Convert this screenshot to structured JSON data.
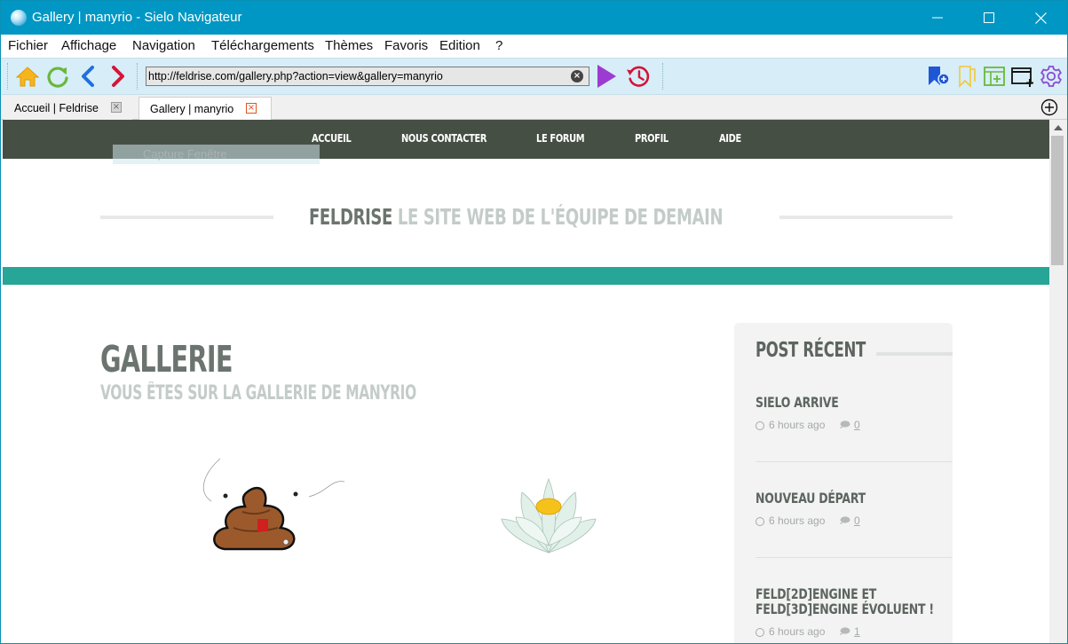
{
  "window": {
    "title": "Gallery | manyrio - Sielo Navigateur"
  },
  "menu": {
    "items": [
      "Fichier",
      "Affichage",
      "Navigation",
      "Téléchargements",
      "Thèmes",
      "Favoris",
      "Edition",
      "?"
    ]
  },
  "toolbar": {
    "url": "http://feldrise.com/gallery.php?action=view&gallery=manyrio"
  },
  "tabs": [
    {
      "label": "Accueil | Feldrise",
      "active": false
    },
    {
      "label": "Gallery | manyrio",
      "active": true
    }
  ],
  "site": {
    "nav": [
      "ACCUEIL",
      "NOUS CONTACTER",
      "LE FORUM",
      "PROFIL",
      "AIDE"
    ],
    "ghost_label": "Capture Fenêtre",
    "hero": {
      "brand": "FELDRISE",
      "tagline": "LE SITE WEB DE L'ÉQUIPE DE DEMAIN"
    },
    "page": {
      "heading": "GALLERIE",
      "subheading": "VOUS ÊTES SUR LA GALLERIE DE MANYRIO"
    },
    "sidebar": {
      "title": "POST RÉCENT",
      "posts": [
        {
          "title_lines": [
            "SIELO ARRIVE"
          ],
          "time": "6 hours ago",
          "comments": "0"
        },
        {
          "title_lines": [
            "NOUVEAU DÉPART"
          ],
          "time": "6 hours ago",
          "comments": "0"
        },
        {
          "title_lines": [
            "FELD[2D]ENGINE ET",
            "FELD[3D]ENGINE ÉVOLUENT !"
          ],
          "time": "6 hours ago",
          "comments": "1"
        }
      ]
    }
  },
  "colors": {
    "titlebar": "#0097c4",
    "toolbar": "#d7edf7",
    "site_nav": "#464f44",
    "teal_band": "#27a596",
    "heading": "#6c746f",
    "muted_heading": "#c3ccc8"
  }
}
